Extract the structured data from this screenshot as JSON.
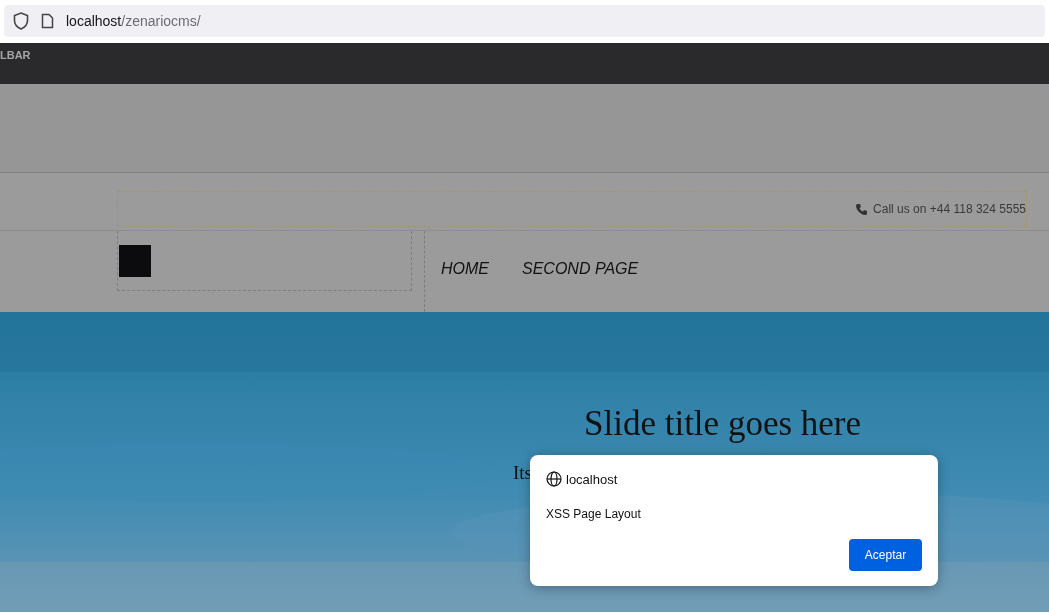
{
  "browser": {
    "url_host": "localhost",
    "url_path": "/zenariocms/"
  },
  "admin_toolbar": {
    "label": "LBAR"
  },
  "header": {
    "phone": "Call us on +44 118 324 5555",
    "nav": [
      {
        "label": "HOME"
      },
      {
        "label": "SECOND PAGE"
      }
    ]
  },
  "slide": {
    "title": "Slide title goes here",
    "text": "Its"
  },
  "dialog": {
    "origin": "localhost",
    "message": "XSS Page Layout",
    "button": "Aceptar"
  }
}
